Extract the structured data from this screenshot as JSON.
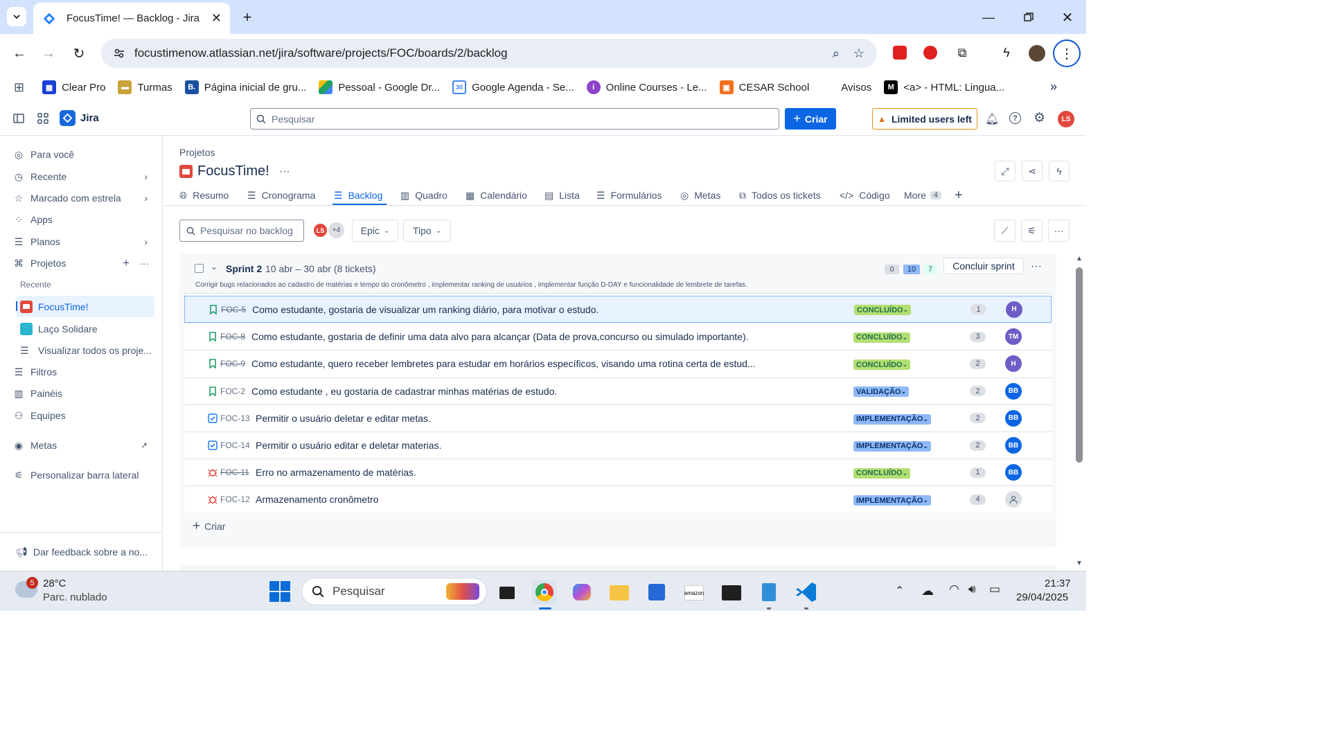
{
  "browser": {
    "tab_title": "FocusTime! — Backlog - Jira",
    "url": "focustimenow.atlassian.net/jira/software/projects/FOC/boards/2/backlog",
    "bookmarks": [
      {
        "label": "Clear Pro",
        "color": "#1a3fd6"
      },
      {
        "label": "Turmas",
        "color": "#c9a33a"
      },
      {
        "label": "Página inicial de gru...",
        "color": "#1a4fa0"
      },
      {
        "label": "Pessoal - Google Dr...",
        "color": "#1ea362"
      },
      {
        "label": "Google Agenda - Se...",
        "color": "#4285f4"
      },
      {
        "label": "Online Courses - Le...",
        "color": "#8e44c9"
      },
      {
        "label": "CESAR School",
        "color": "#f37021"
      },
      {
        "label": "Avisos",
        "color": "#ffffff"
      },
      {
        "label": "<a> - HTML: Lingua...",
        "color": "#000000"
      }
    ]
  },
  "jira": {
    "app_name": "Jira",
    "search_placeholder": "Pesquisar",
    "create_label": "Criar",
    "limited_label": "Limited users left",
    "user_initials": "LS"
  },
  "sidebar": {
    "items": [
      {
        "label": "Para você",
        "icon": "person-circle-icon"
      },
      {
        "label": "Recente",
        "icon": "clock-icon"
      },
      {
        "label": "Marcado com estrela",
        "icon": "star-icon"
      },
      {
        "label": "Apps",
        "icon": "apps-icon"
      },
      {
        "label": "Planos",
        "icon": "plans-icon"
      },
      {
        "label": "Projetos",
        "icon": "projects-icon"
      }
    ],
    "recent_heading": "Recente",
    "projects": [
      {
        "label": "FocusTime!"
      },
      {
        "label": "Laço Solidare"
      },
      {
        "label": "Visualizar todos os proje..."
      }
    ],
    "bottom_items": [
      {
        "label": "Filtros"
      },
      {
        "label": "Painéis"
      },
      {
        "label": "Equipes"
      }
    ],
    "goals": "Metas",
    "customize": "Personalizar barra lateral",
    "feedback": "Dar feedback sobre a no..."
  },
  "project": {
    "breadcrumb": "Projetos",
    "name": "FocusTime!",
    "tabs": [
      "Resumo",
      "Cronograma",
      "Backlog",
      "Quadro",
      "Calendário",
      "Lista",
      "Formulários",
      "Metas",
      "Todos os tickets",
      "Código",
      "More"
    ],
    "more_count": "4",
    "active_tab": "Backlog"
  },
  "backlog": {
    "search_placeholder": "Pesquisar no backlog",
    "avatar_extra": "+4",
    "filter_epic": "Epic",
    "filter_type": "Tipo",
    "sprint": {
      "name": "Sprint 2",
      "dates": "10 abr – 30 abr (8 tickets)",
      "count_todo": "0",
      "count_progress": "10",
      "count_done": "7",
      "complete_label": "Concluir sprint",
      "goal": "Corrigir bugs relacionados ao cadastro de matérias e tempo do cronômetro , implementar ranking de usuários , implementar função D-DAY e funcionalidade de lembrete de tarefas."
    },
    "issues": [
      {
        "key": "FOC-5",
        "summary": "Como estudante, gostaria de visualizar um ranking diário, para motivar o estudo.",
        "status": "CONCLUÍDO",
        "points": "1",
        "assignee": "H",
        "type": "story",
        "done": true
      },
      {
        "key": "FOC-8",
        "summary": "Como estudante, gostaria de definir uma data alvo para alcançar (Data de prova,concurso ou simulado importante).",
        "status": "CONCLUÍDO",
        "points": "3",
        "assignee": "TM",
        "type": "story",
        "done": true
      },
      {
        "key": "FOC-9",
        "summary": "Como estudante, quero receber lembretes para estudar em horários específicos, visando uma rotina certa de estud...",
        "status": "CONCLUÍDO",
        "points": "2",
        "assignee": "H",
        "type": "story",
        "done": true
      },
      {
        "key": "FOC-2",
        "summary": "Como estudante , eu gostaria de cadastrar minhas matérias de estudo.",
        "status": "VALIDAÇÃO",
        "points": "2",
        "assignee": "BB",
        "type": "story",
        "done": false
      },
      {
        "key": "FOC-13",
        "summary": "Permitir o usuário deletar e editar metas.",
        "status": "IMPLEMENTAÇÃO",
        "points": "2",
        "assignee": "BB",
        "type": "task",
        "done": false
      },
      {
        "key": "FOC-14",
        "summary": "Permitir o usuário editar e deletar materias.",
        "status": "IMPLEMENTAÇÃO",
        "points": "2",
        "assignee": "BB",
        "type": "task",
        "done": false
      },
      {
        "key": "FOC-11",
        "summary": "Erro no armazenamento de matérias.",
        "status": "CONCLUÍDO",
        "points": "1",
        "assignee": "BB",
        "type": "bug",
        "done": true
      },
      {
        "key": "FOC-12",
        "summary": "Armazenamento cronômetro",
        "status": "IMPLEMENTAÇÃO",
        "points": "4",
        "assignee": "",
        "type": "bug",
        "done": false
      }
    ],
    "create_label": "Criar"
  },
  "taskbar": {
    "weather_temp": "28°C",
    "weather_desc": "Parc. nublado",
    "weather_badge": "5",
    "search_placeholder": "Pesquisar",
    "time": "21:37",
    "date": "29/04/2025"
  }
}
